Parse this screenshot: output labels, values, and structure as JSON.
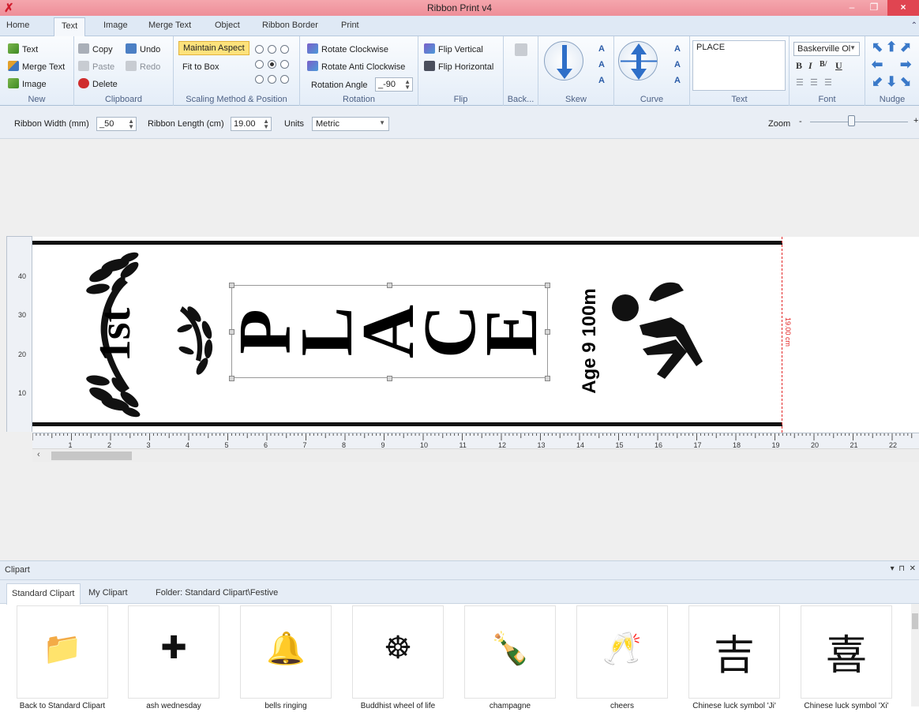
{
  "window": {
    "title": "Ribbon Print v4",
    "min": "–",
    "max": "❐",
    "close": "×"
  },
  "tabs": [
    "Home",
    "Text",
    "Image",
    "Merge Text",
    "Object",
    "Ribbon Border",
    "Print"
  ],
  "ribbon": {
    "new": {
      "label": "New",
      "text": "Text",
      "merge_text": "Merge Text",
      "image": "Image"
    },
    "clipboard": {
      "label": "Clipboard",
      "copy": "Copy",
      "paste": "Paste",
      "delete": "Delete",
      "undo": "Undo",
      "redo": "Redo"
    },
    "scaling": {
      "label": "Scaling Method & Position",
      "maintain_aspect": "Maintain Aspect",
      "fit_to_box": "Fit to Box",
      "selected_position": "center"
    },
    "rotation": {
      "label": "Rotation",
      "clockwise": "Rotate Clockwise",
      "anti_clockwise": "Rotate Anti Clockwise",
      "angle_label": "Rotation Angle",
      "angle_value": "_-90"
    },
    "flip": {
      "label": "Flip",
      "vertical": "Flip Vertical",
      "horizontal": "Flip Horizontal"
    },
    "back": {
      "label": "Back..."
    },
    "skew": {
      "label": "Skew"
    },
    "curve": {
      "label": "Curve"
    },
    "text": {
      "label": "Text",
      "value": "PLACE"
    },
    "font": {
      "label": "Font",
      "family": "Baskerville Ol",
      "bold": "B",
      "italic": "I",
      "subscript": "B/",
      "underline": "U"
    },
    "nudge": {
      "label": "Nudge"
    }
  },
  "settings": {
    "width_label": "Ribbon Width (mm)",
    "width_value": "_50",
    "length_label": "Ribbon Length (cm)",
    "length_value": "19.00",
    "units_label": "Units",
    "units_value": "Metric",
    "zoom_label": "Zoom",
    "zoom_level": 0.42
  },
  "canvas": {
    "place_letters": [
      "P",
      "L",
      "A",
      "C",
      "E"
    ],
    "first_text": "1st",
    "age_text": "Age 9 100m",
    "cut_label": "19.00 cm",
    "vruler": [
      "40",
      "30",
      "20",
      "10"
    ],
    "hruler": [
      "1",
      "2",
      "3",
      "4",
      "5",
      "6",
      "7",
      "8",
      "9",
      "10",
      "11",
      "12",
      "13",
      "14",
      "15",
      "16",
      "17",
      "18",
      "19",
      "20",
      "21",
      "22"
    ]
  },
  "clipart": {
    "title": "Clipart",
    "tabs": [
      "Standard Clipart",
      "My Clipart"
    ],
    "folder": "Folder: Standard Clipart\\Festive",
    "items": [
      {
        "name": "Back to Standard Clipart",
        "icon": "folder-back-icon",
        "glyph": "📁"
      },
      {
        "name": "ash wednesday",
        "icon": "cross-icon",
        "glyph": "✚"
      },
      {
        "name": "bells ringing",
        "icon": "bells-icon",
        "glyph": "🔔"
      },
      {
        "name": "Buddhist wheel of life",
        "icon": "dharma-wheel-icon",
        "glyph": "☸"
      },
      {
        "name": "champagne",
        "icon": "champagne-icon",
        "glyph": "🍾"
      },
      {
        "name": "cheers",
        "icon": "cheers-icon",
        "glyph": "🥂"
      },
      {
        "name": "Chinese luck symbol 'Ji'",
        "icon": "ji-character-icon",
        "glyph": "吉"
      },
      {
        "name": "Chinese luck symbol 'Xi'",
        "icon": "xi-character-icon",
        "glyph": "喜"
      }
    ]
  }
}
